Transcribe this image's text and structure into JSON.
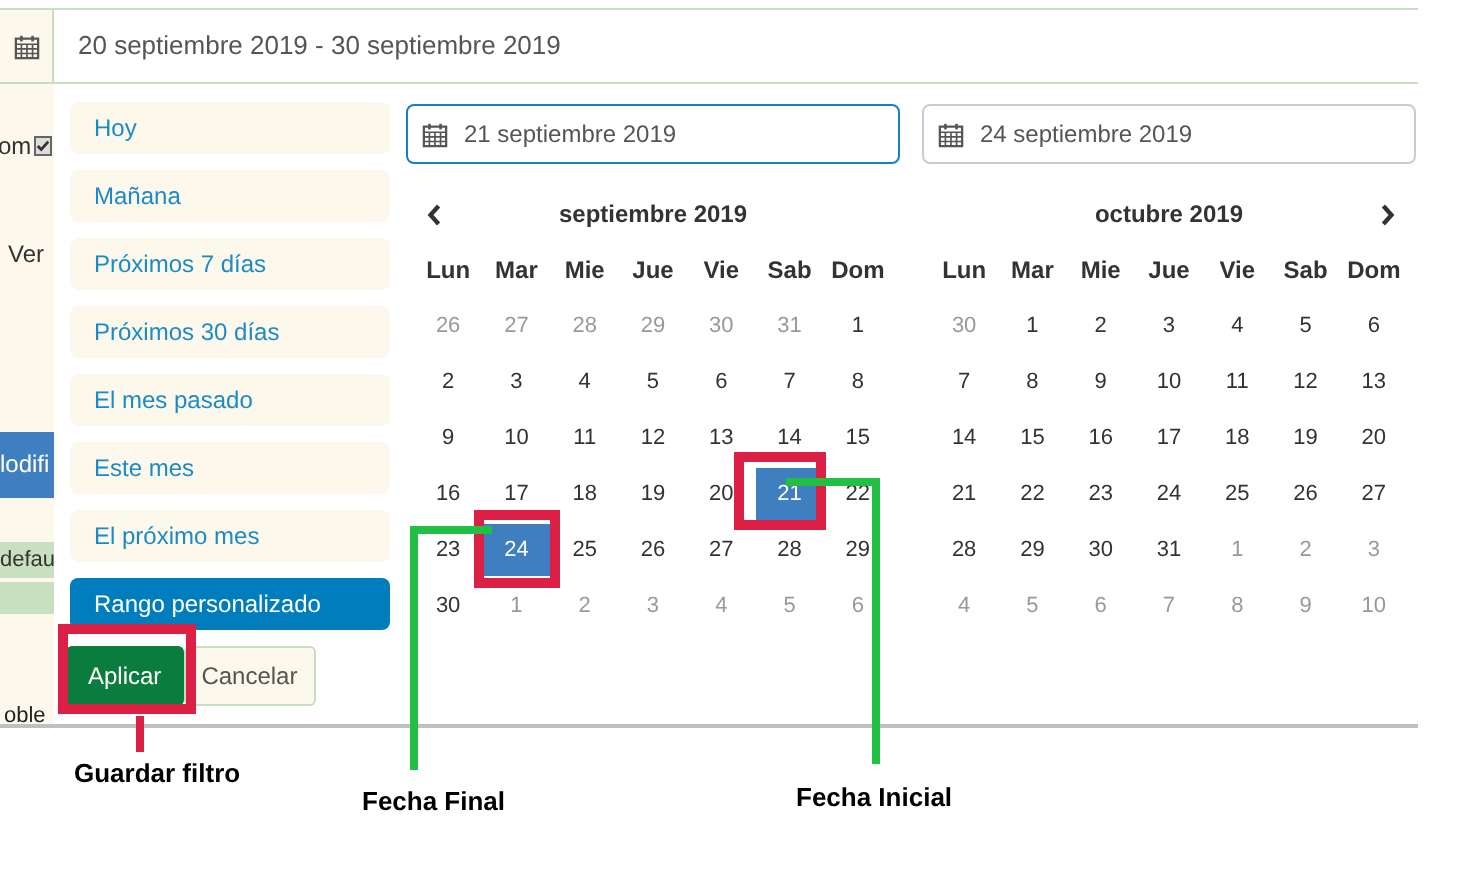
{
  "date_range": {
    "value": "20 septiembre 2019 - 30 septiembre 2019"
  },
  "background_fragments": {
    "label_1": "om",
    "label_2": "Ver",
    "checkbox_checked": true,
    "button": "lodifi",
    "row_1": "defau",
    "row_2": "oble"
  },
  "ranges": [
    {
      "label": "Hoy",
      "selected": false
    },
    {
      "label": "Mañana",
      "selected": false
    },
    {
      "label": "Próximos 7 días",
      "selected": false
    },
    {
      "label": "Próximos 30 días",
      "selected": false
    },
    {
      "label": "El mes pasado",
      "selected": false
    },
    {
      "label": "Este mes",
      "selected": false
    },
    {
      "label": "El próximo mes",
      "selected": false
    },
    {
      "label": "Rango personalizado",
      "selected": true
    }
  ],
  "buttons": {
    "apply": "Aplicar",
    "cancel": "Cancelar"
  },
  "calendars": [
    {
      "input": "21 septiembre 2019",
      "focused": true,
      "title": "septiembre 2019",
      "prev_arrow": true,
      "weekdays": [
        "Lun",
        "Mar",
        "Mie",
        "Jue",
        "Vie",
        "Sab",
        "Dom"
      ],
      "days": [
        {
          "text": "26",
          "outside_month": true,
          "selected": false
        },
        {
          "text": "27",
          "outside_month": true,
          "selected": false
        },
        {
          "text": "28",
          "outside_month": true,
          "selected": false
        },
        {
          "text": "29",
          "outside_month": true,
          "selected": false
        },
        {
          "text": "30",
          "outside_month": true,
          "selected": false
        },
        {
          "text": "31",
          "outside_month": true,
          "selected": false
        },
        {
          "text": "1",
          "outside_month": false,
          "selected": false
        },
        {
          "text": "2",
          "outside_month": false,
          "selected": false
        },
        {
          "text": "3",
          "outside_month": false,
          "selected": false
        },
        {
          "text": "4",
          "outside_month": false,
          "selected": false
        },
        {
          "text": "5",
          "outside_month": false,
          "selected": false
        },
        {
          "text": "6",
          "outside_month": false,
          "selected": false
        },
        {
          "text": "7",
          "outside_month": false,
          "selected": false
        },
        {
          "text": "8",
          "outside_month": false,
          "selected": false
        },
        {
          "text": "9",
          "outside_month": false,
          "selected": false
        },
        {
          "text": "10",
          "outside_month": false,
          "selected": false
        },
        {
          "text": "11",
          "outside_month": false,
          "selected": false
        },
        {
          "text": "12",
          "outside_month": false,
          "selected": false
        },
        {
          "text": "13",
          "outside_month": false,
          "selected": false
        },
        {
          "text": "14",
          "outside_month": false,
          "selected": false
        },
        {
          "text": "15",
          "outside_month": false,
          "selected": false
        },
        {
          "text": "16",
          "outside_month": false,
          "selected": false
        },
        {
          "text": "17",
          "outside_month": false,
          "selected": false
        },
        {
          "text": "18",
          "outside_month": false,
          "selected": false
        },
        {
          "text": "19",
          "outside_month": false,
          "selected": false
        },
        {
          "text": "20",
          "outside_month": false,
          "selected": false
        },
        {
          "text": "21",
          "outside_month": false,
          "selected": true
        },
        {
          "text": "22",
          "outside_month": false,
          "selected": false
        },
        {
          "text": "23",
          "outside_month": false,
          "selected": false
        },
        {
          "text": "24",
          "outside_month": false,
          "selected": true
        },
        {
          "text": "25",
          "outside_month": false,
          "selected": false
        },
        {
          "text": "26",
          "outside_month": false,
          "selected": false
        },
        {
          "text": "27",
          "outside_month": false,
          "selected": false
        },
        {
          "text": "28",
          "outside_month": false,
          "selected": false
        },
        {
          "text": "29",
          "outside_month": false,
          "selected": false
        },
        {
          "text": "30",
          "outside_month": false,
          "selected": false
        },
        {
          "text": "1",
          "outside_month": true,
          "selected": false
        },
        {
          "text": "2",
          "outside_month": true,
          "selected": false
        },
        {
          "text": "3",
          "outside_month": true,
          "selected": false
        },
        {
          "text": "4",
          "outside_month": true,
          "selected": false
        },
        {
          "text": "5",
          "outside_month": true,
          "selected": false
        },
        {
          "text": "6",
          "outside_month": true,
          "selected": false
        }
      ]
    },
    {
      "input": "24 septiembre 2019",
      "focused": false,
      "title": "octubre 2019",
      "next_arrow": true,
      "weekdays": [
        "Lun",
        "Mar",
        "Mie",
        "Jue",
        "Vie",
        "Sab",
        "Dom"
      ],
      "days": [
        {
          "text": "30",
          "outside_month": true,
          "selected": false
        },
        {
          "text": "1",
          "outside_month": false,
          "selected": false
        },
        {
          "text": "2",
          "outside_month": false,
          "selected": false
        },
        {
          "text": "3",
          "outside_month": false,
          "selected": false
        },
        {
          "text": "4",
          "outside_month": false,
          "selected": false
        },
        {
          "text": "5",
          "outside_month": false,
          "selected": false
        },
        {
          "text": "6",
          "outside_month": false,
          "selected": false
        },
        {
          "text": "7",
          "outside_month": false,
          "selected": false
        },
        {
          "text": "8",
          "outside_month": false,
          "selected": false
        },
        {
          "text": "9",
          "outside_month": false,
          "selected": false
        },
        {
          "text": "10",
          "outside_month": false,
          "selected": false
        },
        {
          "text": "11",
          "outside_month": false,
          "selected": false
        },
        {
          "text": "12",
          "outside_month": false,
          "selected": false
        },
        {
          "text": "13",
          "outside_month": false,
          "selected": false
        },
        {
          "text": "14",
          "outside_month": false,
          "selected": false
        },
        {
          "text": "15",
          "outside_month": false,
          "selected": false
        },
        {
          "text": "16",
          "outside_month": false,
          "selected": false
        },
        {
          "text": "17",
          "outside_month": false,
          "selected": false
        },
        {
          "text": "18",
          "outside_month": false,
          "selected": false
        },
        {
          "text": "19",
          "outside_month": false,
          "selected": false
        },
        {
          "text": "20",
          "outside_month": false,
          "selected": false
        },
        {
          "text": "21",
          "outside_month": false,
          "selected": false
        },
        {
          "text": "22",
          "outside_month": false,
          "selected": false
        },
        {
          "text": "23",
          "outside_month": false,
          "selected": false
        },
        {
          "text": "24",
          "outside_month": false,
          "selected": false
        },
        {
          "text": "25",
          "outside_month": false,
          "selected": false
        },
        {
          "text": "26",
          "outside_month": false,
          "selected": false
        },
        {
          "text": "27",
          "outside_month": false,
          "selected": false
        },
        {
          "text": "28",
          "outside_month": false,
          "selected": false
        },
        {
          "text": "29",
          "outside_month": false,
          "selected": false
        },
        {
          "text": "30",
          "outside_month": false,
          "selected": false
        },
        {
          "text": "31",
          "outside_month": false,
          "selected": false
        },
        {
          "text": "1",
          "outside_month": true,
          "selected": false
        },
        {
          "text": "2",
          "outside_month": true,
          "selected": false
        },
        {
          "text": "3",
          "outside_month": true,
          "selected": false
        },
        {
          "text": "4",
          "outside_month": true,
          "selected": false
        },
        {
          "text": "5",
          "outside_month": true,
          "selected": false
        },
        {
          "text": "6",
          "outside_month": true,
          "selected": false
        },
        {
          "text": "7",
          "outside_month": true,
          "selected": false
        },
        {
          "text": "8",
          "outside_month": true,
          "selected": false
        },
        {
          "text": "9",
          "outside_month": true,
          "selected": false
        },
        {
          "text": "10",
          "outside_month": true,
          "selected": false
        }
      ]
    }
  ],
  "annotations": [
    {
      "label": "Guardar filtro",
      "color": "#dc1f45"
    },
    {
      "label": "Fecha Final",
      "color": "#22c042"
    },
    {
      "label": "Fecha Inicial",
      "color": "#22c042"
    }
  ]
}
